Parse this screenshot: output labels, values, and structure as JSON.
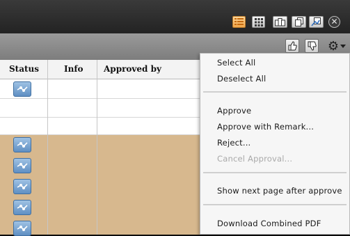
{
  "toolbar": {
    "view_buttons": [
      {
        "icon": "list-view-icon",
        "active": true
      },
      {
        "icon": "grid-view-icon",
        "active": false
      },
      {
        "icon": "side-by-side-view-icon",
        "active": false
      },
      {
        "icon": "stacked-view-icon",
        "active": false
      },
      {
        "icon": "compare-view-icon",
        "active": false
      }
    ],
    "close_icon": "close-icon"
  },
  "action_bar": {
    "buttons": [
      "approve-thumbs-up-icon",
      "reject-thumbs-down-icon",
      "settings-gear-icon"
    ]
  },
  "table": {
    "columns": [
      "Status",
      "Info",
      "Approved by"
    ],
    "rows": [
      {
        "status_icon": "workflow-status-icon",
        "highlight": false
      },
      {
        "status_icon": "",
        "highlight": false
      },
      {
        "status_icon": "",
        "highlight": false
      },
      {
        "status_icon": "workflow-status-icon",
        "highlight": true
      },
      {
        "status_icon": "workflow-status-icon",
        "highlight": true
      },
      {
        "status_icon": "workflow-status-icon",
        "highlight": true
      },
      {
        "status_icon": "workflow-status-icon",
        "highlight": true
      },
      {
        "status_icon": "workflow-status-icon",
        "highlight": true
      }
    ],
    "highlight_color": "#d7b88e",
    "status_icon_color": "#6f9bd0"
  },
  "menu": {
    "items": [
      {
        "label": "Select All",
        "disabled": false
      },
      {
        "label": "Deselect All",
        "disabled": false
      },
      {
        "label": "Approve",
        "disabled": false
      },
      {
        "label": "Approve with Remark...",
        "disabled": false
      },
      {
        "label": "Reject...",
        "disabled": false
      },
      {
        "label": "Cancel Approval...",
        "disabled": true
      },
      {
        "label": "Show next page after approve",
        "disabled": false
      },
      {
        "label": "Download Combined PDF",
        "disabled": false
      }
    ]
  }
}
